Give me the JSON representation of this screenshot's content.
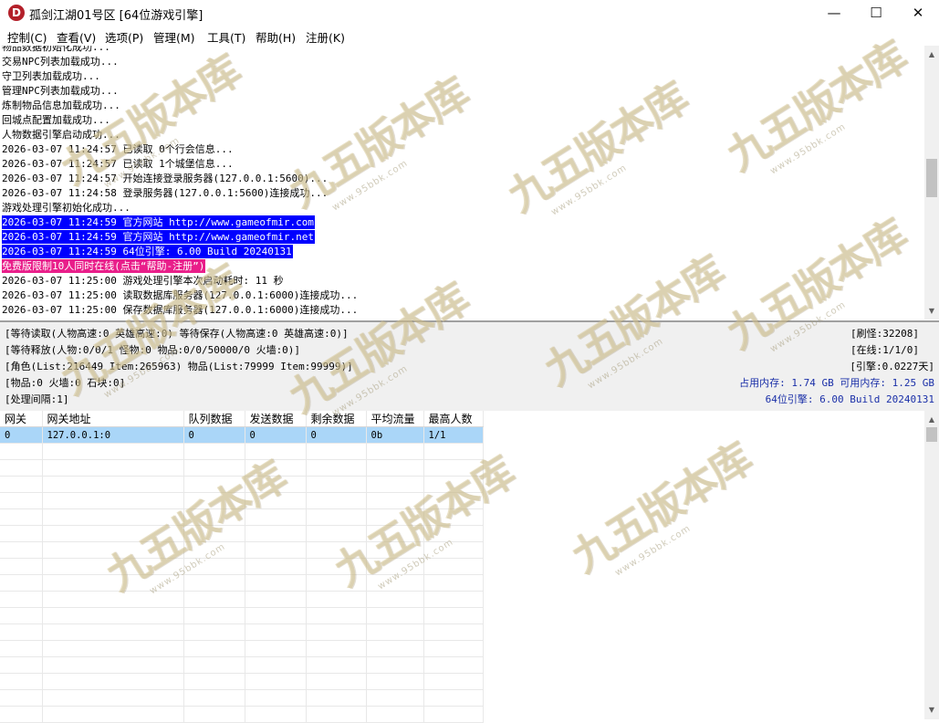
{
  "window": {
    "icon_letter": "D",
    "title": "孤剑江湖01号区 [64位游戏引擎]",
    "minimize_glyph": "—",
    "maximize_glyph": "☐",
    "close_glyph": "✕"
  },
  "menu": [
    "控制(C)",
    "查看(V)",
    "选项(P)",
    "管理(M)",
    "工具(T)",
    "帮助(H)",
    "注册(K)"
  ],
  "log_lines": [
    {
      "text": "物品数据初始化成功...",
      "hl": ""
    },
    {
      "text": "交易NPC列表加载成功...",
      "hl": ""
    },
    {
      "text": "守卫列表加载成功...",
      "hl": ""
    },
    {
      "text": "管理NPC列表加载成功...",
      "hl": ""
    },
    {
      "text": "炼制物品信息加载成功...",
      "hl": ""
    },
    {
      "text": "回城点配置加载成功...",
      "hl": ""
    },
    {
      "text": "人物数据引擎启动成功...",
      "hl": ""
    },
    {
      "text": "2026-03-07 11:24:57 已读取 0个行会信息...",
      "hl": ""
    },
    {
      "text": "2026-03-07 11:24:57 已读取 1个城堡信息...",
      "hl": ""
    },
    {
      "text": "2026-03-07 11:24:57 开始连接登录服务器(127.0.0.1:5600)...",
      "hl": ""
    },
    {
      "text": "2026-03-07 11:24:58 登录服务器(127.0.0.1:5600)连接成功...",
      "hl": ""
    },
    {
      "text": "游戏处理引擎初始化成功...",
      "hl": ""
    },
    {
      "text": "2026-03-07 11:24:59 官方网站 http://www.gameofmir.com",
      "hl": "blue"
    },
    {
      "text": "2026-03-07 11:24:59 官方网站 http://www.gameofmir.net",
      "hl": "blue"
    },
    {
      "text": "2026-03-07 11:24:59 64位引擎: 6.00 Build 20240131",
      "hl": "blue"
    },
    {
      "text": "免费版限制10人同时在线(点击“帮助-注册”)",
      "hl": "pink"
    },
    {
      "text": "2026-03-07 11:25:00 游戏处理引擎本次启动耗时: 11 秒",
      "hl": ""
    },
    {
      "text": "2026-03-07 11:25:00 读取数据库服务器(127.0.0.1:6000)连接成功...",
      "hl": ""
    },
    {
      "text": "2026-03-07 11:25:00 保存数据库服务器(127.0.0.1:6000)连接成功...",
      "hl": ""
    }
  ],
  "status": {
    "line1": "[等待读取(人物高速:0 英雄高速:0) 等待保存(人物高速:0 英雄高速:0)]",
    "line2": "[等待释放(人物:0/0/1 怪物:0 物品:0/0/50000/0 火墙:0)]",
    "line3": "[角色(List:216449 Item:265963) 物品(List:79999 Item:99999)]",
    "line4": "[物品:0 火墙:0 石块:0]",
    "line5": "[处理间隔:1]",
    "refresh": "[刷怪:32208]",
    "online": "[在线:1/1/0]",
    "engine_days": "[引擎:0.0227天]",
    "memory": "占用内存: 1.74 GB 可用内存: 1.25 GB",
    "version": "64位引擎: 6.00 Build 20240131"
  },
  "gateway_table": {
    "headers": [
      "网关",
      "网关地址",
      "队列数据",
      "发送数据",
      "剩余数据",
      "平均流量",
      "最高人数"
    ],
    "rows": [
      [
        "0",
        "127.0.0.1:0",
        "0",
        "0",
        "0",
        "0b",
        "1/1"
      ]
    ]
  },
  "watermark": {
    "main": "九五版本库",
    "sub": "www.95bbk.com"
  },
  "colors": {
    "highlight_blue": "#0000ff",
    "highlight_pink": "#e91e8a",
    "selected_row": "#aad6f8",
    "info_blue": "#1a2fa8"
  }
}
